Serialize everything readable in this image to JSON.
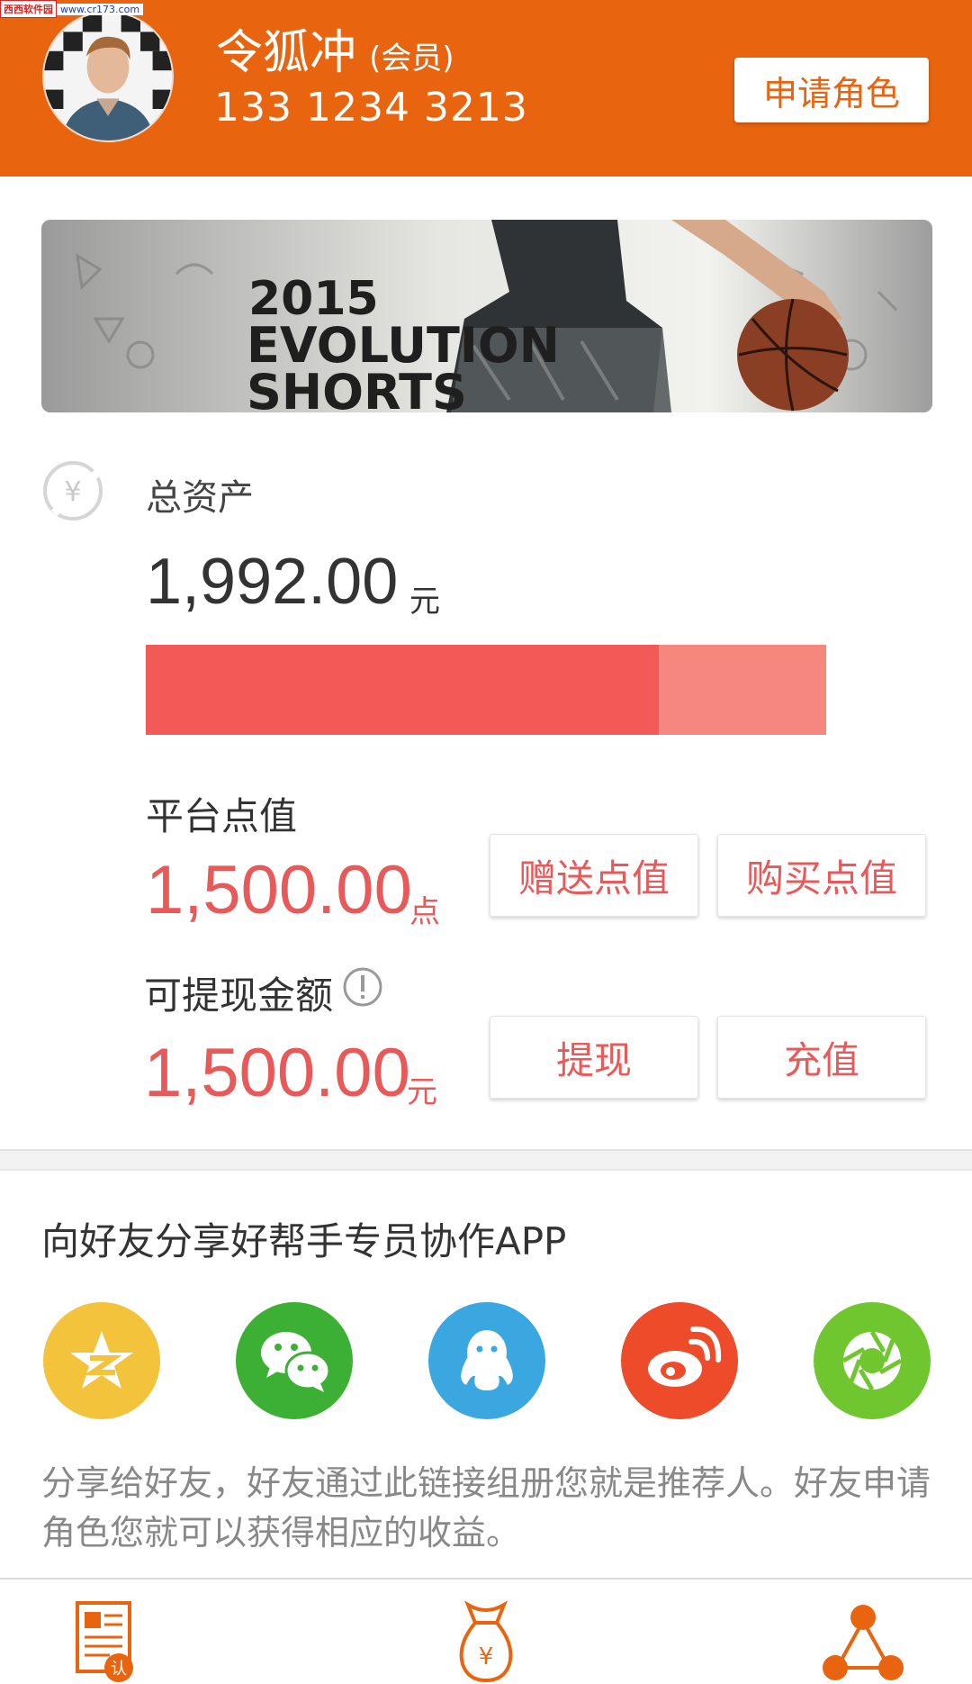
{
  "watermark": {
    "site_name": "西西软件园",
    "url": "www.cr173.com"
  },
  "user": {
    "name": "令狐冲",
    "role": "(会员)",
    "phone": "133 1234 3213",
    "apply_button": "申请角色"
  },
  "banner": {
    "line1": "2015",
    "line2": "EVOLUTION",
    "line3": "SHORTS"
  },
  "assets": {
    "label": "总资产",
    "value": "1,992.00",
    "unit": "元",
    "icon": "yuan-coin-icon",
    "bar_fill_fraction": 0.754
  },
  "points": {
    "label": "平台点值",
    "value": "1,500.00",
    "unit": "点",
    "gift_button": "赠送点值",
    "buy_button": "购买点值"
  },
  "cash": {
    "label": "可提现金额",
    "value": "1,500.00",
    "unit": "元",
    "withdraw_button": "提现",
    "recharge_button": "充值"
  },
  "share": {
    "title": "向好友分享好帮手专员协作APP",
    "description": "分享给好友，好友通过此链接组册您就是推荐人。好友申请角色您就可以获得相应的收益。",
    "channels": [
      {
        "icon": "qzone-icon",
        "color": "#f3c33b"
      },
      {
        "icon": "wechat-icon",
        "color": "#3cb035"
      },
      {
        "icon": "qq-icon",
        "color": "#3aa7e0"
      },
      {
        "icon": "weibo-icon",
        "color": "#ee4b2b"
      },
      {
        "icon": "moments-icon",
        "color": "#6fc62f"
      }
    ]
  },
  "bottom_nav": {
    "items": [
      {
        "icon": "document-verify-icon"
      },
      {
        "icon": "money-bag-icon"
      },
      {
        "icon": "share-network-icon"
      }
    ]
  },
  "colors": {
    "header": "#e8640f",
    "accent_red": "#e85a5a",
    "bar_primary": "#f25a58",
    "bar_secondary": "#f6877e"
  }
}
